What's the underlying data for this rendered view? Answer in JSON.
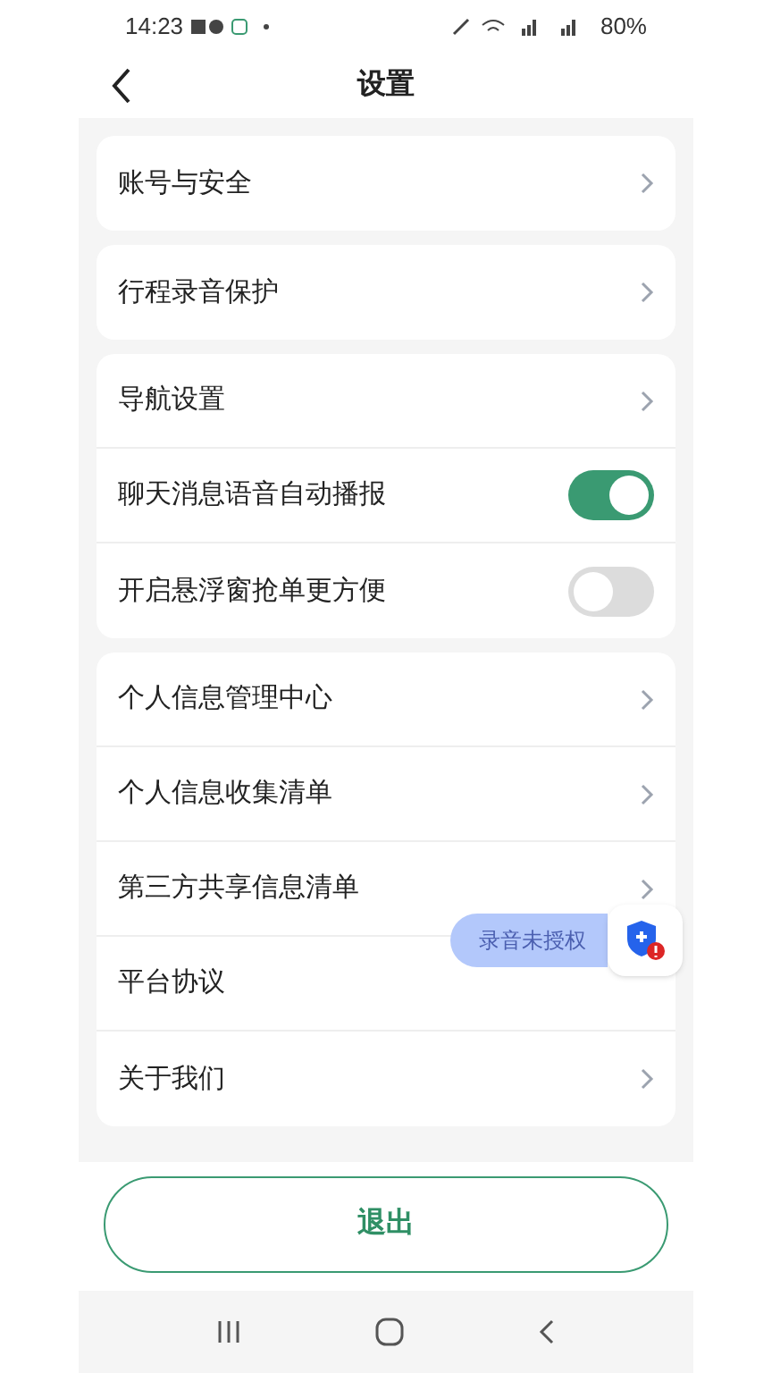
{
  "status_bar": {
    "time": "14:23",
    "battery": "80%"
  },
  "header": {
    "title": "设置"
  },
  "groups": [
    {
      "items": [
        {
          "kind": "link",
          "label": "账号与安全",
          "chevron": true
        }
      ]
    },
    {
      "items": [
        {
          "kind": "link",
          "label": "行程录音保护",
          "chevron": true
        }
      ]
    },
    {
      "items": [
        {
          "kind": "link",
          "label": "导航设置",
          "chevron": true
        },
        {
          "kind": "toggle",
          "label": "聊天消息语音自动播报",
          "on": true
        },
        {
          "kind": "toggle",
          "label": "开启悬浮窗抢单更方便",
          "on": false
        }
      ]
    },
    {
      "items": [
        {
          "kind": "link",
          "label": "个人信息管理中心",
          "chevron": true
        },
        {
          "kind": "link",
          "label": "个人信息收集清单",
          "chevron": true
        },
        {
          "kind": "link",
          "label": "第三方共享信息清单",
          "chevron": true
        },
        {
          "kind": "link",
          "label": "平台协议",
          "chevron": false
        },
        {
          "kind": "link",
          "label": "关于我们",
          "chevron": true
        }
      ]
    }
  ],
  "floating_badge": {
    "label": "录音未授权"
  },
  "logout_button": {
    "label": "退出"
  }
}
